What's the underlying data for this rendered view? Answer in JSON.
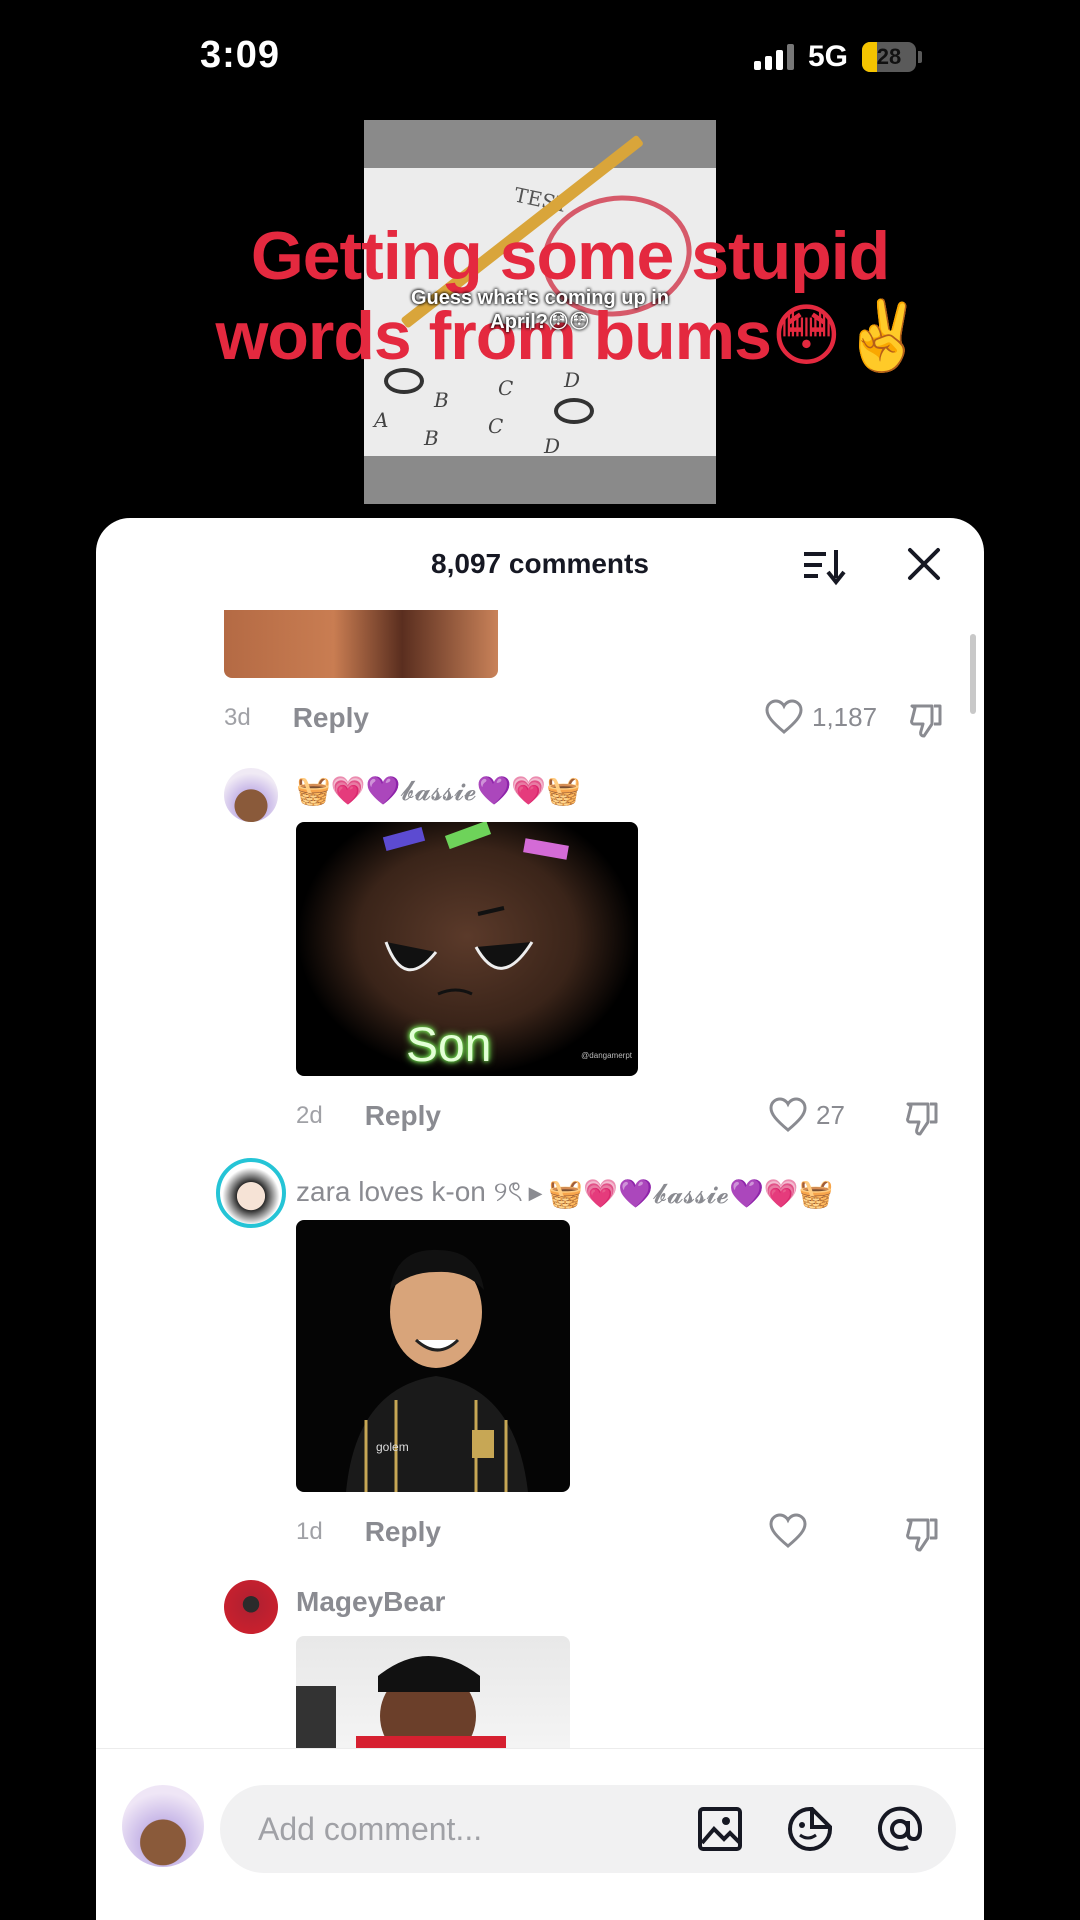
{
  "status_bar": {
    "time": "3:09",
    "network": "5G",
    "battery": "28"
  },
  "video": {
    "paper_title": "TEST",
    "caption_small": "Guess what's coming up in April?😳😳",
    "caption_big": "Getting some stupid words from bums😳✌️"
  },
  "comments_panel": {
    "title": "8,097 comments",
    "comments": [
      {
        "time": "3d",
        "reply": "Reply",
        "likes": "1,187"
      },
      {
        "username": "🧺💗💜𝓫𝓪𝓼𝓼𝓲𝓮💜💗🧺",
        "sticker_text": "Son",
        "sticker_credit": "@dangamerpt",
        "time": "2d",
        "reply": "Reply",
        "likes": "27"
      },
      {
        "username": "zara loves k-on ୨ৎ",
        "reply_to": "🧺💗💜𝓫𝓪𝓼𝓼𝓲𝓮💜💗🧺",
        "shirt_text": "golem",
        "time": "1d",
        "reply": "Reply",
        "likes": ""
      },
      {
        "username": "MageyBear"
      }
    ]
  },
  "input": {
    "placeholder": "Add comment..."
  },
  "colors": {
    "accent_red": "#e4293f",
    "meta_gray": "#8a8b91",
    "battery_yellow": "#f5c400"
  }
}
